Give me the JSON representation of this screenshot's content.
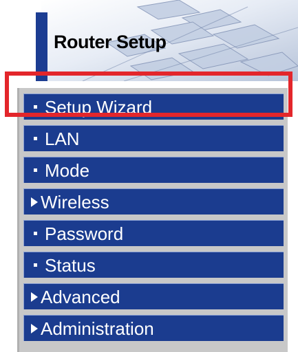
{
  "header": {
    "title": "Router Setup"
  },
  "menu": {
    "items": [
      {
        "label": "Setup Wizard",
        "icon": "bullet-icon"
      },
      {
        "label": "LAN",
        "icon": "bullet-icon"
      },
      {
        "label": "Mode",
        "icon": "bullet-icon"
      },
      {
        "label": "Wireless",
        "icon": "triangle-right-icon"
      },
      {
        "label": "Password",
        "icon": "bullet-icon"
      },
      {
        "label": "Status",
        "icon": "bullet-icon"
      },
      {
        "label": "Advanced",
        "icon": "triangle-right-icon"
      },
      {
        "label": "Administration",
        "icon": "triangle-right-icon"
      }
    ]
  },
  "colors": {
    "menu_item_bg": "#1b3c8f",
    "menu_frame": "#c8c8c8",
    "highlight": "#e3262b",
    "header_bar": "#1c3d92"
  }
}
